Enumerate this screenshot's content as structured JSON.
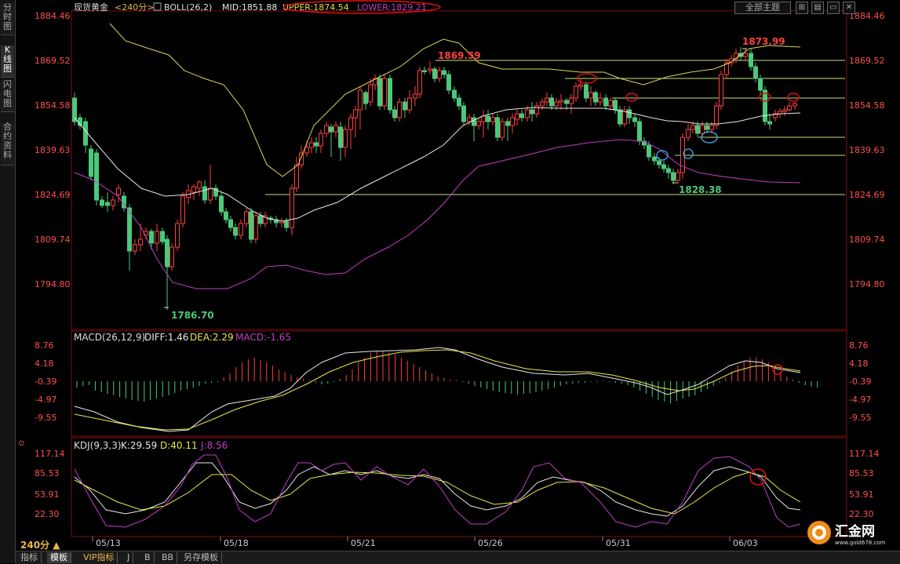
{
  "side_tabs": [
    "分时图",
    "K线图",
    "闪电图",
    "合约资料"
  ],
  "side_active": 1,
  "header": {
    "instrument": "现货黄金",
    "period": "<240分>",
    "indicator": "BOLL(26,2)",
    "mid": "MID:1851.88",
    "upper": "UPPER:1874.54",
    "lower": "LOWER:1829.21"
  },
  "theme_button": "全部主题",
  "window_buttons": [
    "⊞",
    "▤",
    "▭",
    "✕"
  ],
  "price_axis": [
    "1884.46",
    "1869.52",
    "1854.58",
    "1839.63",
    "1824.69",
    "1809.74",
    "1794.80"
  ],
  "annotations": {
    "high1": "1869.59",
    "high2": "1873.99",
    "low1": "1786.70",
    "low2": "1828.38"
  },
  "macd": {
    "title": "MACD(26,12,9)",
    "diff": "DIFF:1.46",
    "dea": "DEA:2.29",
    "macd": "MACD:-1.65",
    "axis": [
      "8.76",
      "4.18",
      "-0.39",
      "-4.97",
      "-9.55"
    ]
  },
  "kdj": {
    "title": "KDJ(9,3,3)",
    "k": "K:29.59",
    "d": "D:40.11",
    "j": "J:8.56",
    "axis": [
      "117.14",
      "85.53",
      "53.91",
      "22.30"
    ]
  },
  "dates": [
    "05/13",
    "05/18",
    "05/21",
    "05/26",
    "05/31",
    "06/03"
  ],
  "period_badge": "240分 ▲",
  "bottom_tabs": [
    "指标",
    "模板",
    "VIP指标",
    "J",
    "B",
    "BB",
    "另存模板"
  ],
  "bottom_active": 1,
  "logo_text": "汇金网",
  "logo_url": "www.gold678.com",
  "colors": {
    "up": "#ff4040",
    "down": "#4cc87a",
    "upper": "#d8d85a",
    "mid": "#e8e8e8",
    "lower": "#c23ec2",
    "dea": "#e8e84a",
    "macd": "#c23ec2",
    "j": "#c23ec2"
  }
}
